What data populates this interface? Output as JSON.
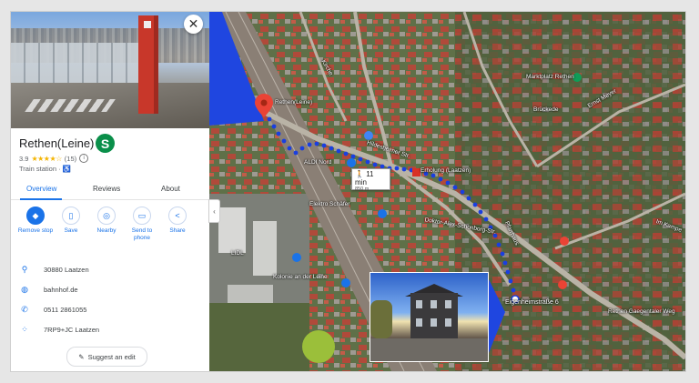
{
  "place": {
    "title": "Rethen(Leine)",
    "rating": "3.9",
    "stars": "★★★★☆",
    "review_count": "(15)",
    "category": "Train station",
    "close_label": "✕",
    "sbahn_label": "S"
  },
  "tabs": [
    {
      "label": "Overview",
      "active": true
    },
    {
      "label": "Reviews",
      "active": false
    },
    {
      "label": "About",
      "active": false
    }
  ],
  "actions": [
    {
      "label": "Remove stop",
      "icon": "remove-stop-icon"
    },
    {
      "label": "Save",
      "icon": "bookmark-icon"
    },
    {
      "label": "Nearby",
      "icon": "nearby-icon"
    },
    {
      "label": "Send to phone",
      "icon": "send-to-phone-icon"
    },
    {
      "label": "Share",
      "icon": "share-icon"
    }
  ],
  "details": {
    "address": "30880 Laatzen",
    "website": "bahnhof.de",
    "phone": "0511 2861055",
    "plus_code": "7RP9+JC Laatzen"
  },
  "suggest_edit": "Suggest an edit",
  "map": {
    "labels": {
      "rethen": "Rethen(Leine)",
      "aldi": "ALDI Nord",
      "hildesheimer": "Hildesheimer Str.",
      "erholung": "Erholung (Laatzen)",
      "lidl": "LIDL",
      "schaefer": "Elektro Schäfer",
      "doktor": "Doktor-Alex-Schonborg-Str.",
      "kolonie": "Kolonie an der Leine",
      "marktplatz": "Marktplatz Rethen",
      "brueckede": "Brückede",
      "eigenheim": "Eigenheimstraße 6",
      "gaesten": "Rethen Gaegentaler Weg",
      "kirche": "Kirche",
      "im_kampe": "Im Kampe",
      "ernst": "Ernst Meyer",
      "pfarre": "Pfarrhaus"
    },
    "route": {
      "duration": "11 min",
      "distance": "850 m"
    },
    "colors": {
      "route": "#1a3fe0",
      "pin": "#ea4335",
      "sbahn": "#0a8f4a",
      "accent": "#1a73e8"
    }
  }
}
